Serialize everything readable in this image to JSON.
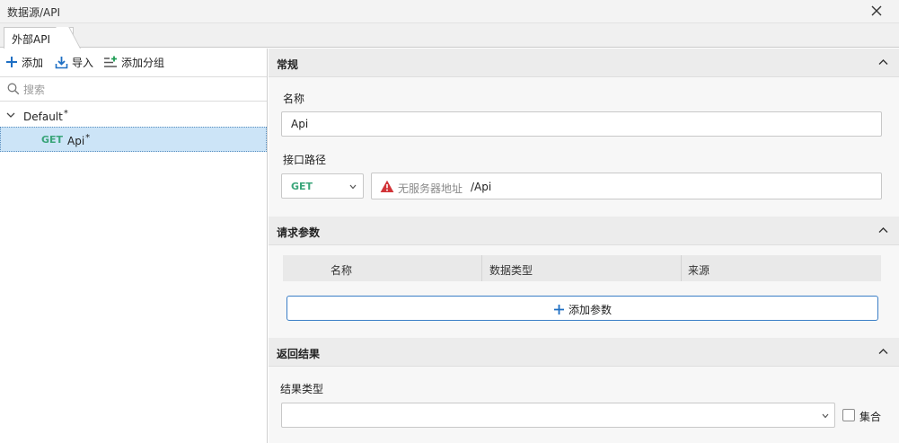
{
  "window": {
    "title": "数据源/API",
    "close_icon": "close-icon"
  },
  "tabs": [
    {
      "label": "外部API",
      "active": true
    }
  ],
  "toolbar": {
    "add_label": "添加",
    "import_label": "导入",
    "add_group_label": "添加分组"
  },
  "search": {
    "placeholder": "搜索",
    "value": ""
  },
  "tree": {
    "group_label": "Default",
    "group_modified": "*",
    "items": [
      {
        "method": "GET",
        "name": "Api",
        "modified": "*",
        "selected": true
      }
    ]
  },
  "general": {
    "header": "常规",
    "name_label": "名称",
    "name_value": "Api",
    "path_label": "接口路径",
    "method_value": "GET",
    "server_text": "无服务器地址",
    "path_value": "/Api"
  },
  "request": {
    "header": "请求参数",
    "columns": [
      "名称",
      "数据类型",
      "来源"
    ],
    "add_param_label": "添加参数"
  },
  "response": {
    "header": "返回结果",
    "result_type_label": "结果类型",
    "result_type_value": "",
    "collection_label": "集合",
    "collection_checked": false
  },
  "colors": {
    "accent": "#1e6fc4",
    "get_method": "#3aa57a",
    "warning": "#d13438",
    "selection": "#cce4f7"
  }
}
